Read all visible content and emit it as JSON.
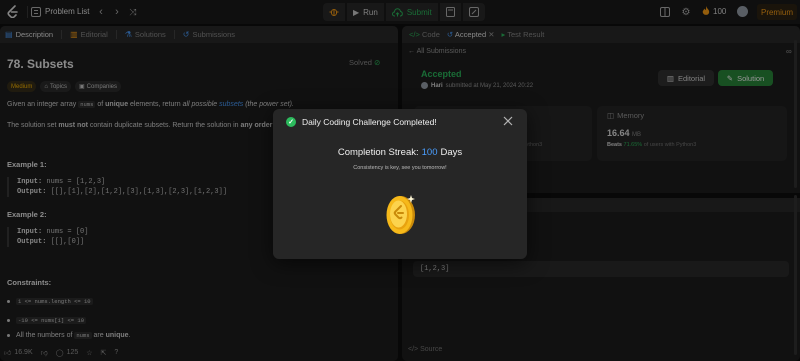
{
  "topbar": {
    "problem_list_label": "Problem List",
    "run_label": "Run",
    "submit_label": "Submit",
    "streak_count": "100",
    "premium_label": "Premium"
  },
  "left_panel": {
    "tabs": [
      {
        "label": "Description"
      },
      {
        "label": "Editorial"
      },
      {
        "label": "Solutions"
      },
      {
        "label": "Submissions"
      }
    ],
    "title": "78. Subsets",
    "solved_label": "Solved",
    "badges": {
      "difficulty": "Medium",
      "topics": "Topics",
      "companies": "Companies"
    },
    "desc_line1": {
      "a": "Given an integer array ",
      "code": "nums",
      "b": " of ",
      "bold": "unique",
      "c": " elements, return ",
      "italic": "all possible ",
      "link": "subsets",
      "d": " (the power set)."
    },
    "desc_line2": {
      "a": "The solution set ",
      "bold": "must not",
      "b": " contain duplicate subsets. Return the solution in ",
      "bold2": "any order",
      "c": "."
    },
    "example1": {
      "heading": "Example 1:",
      "input_label": "Input:",
      "input_value": "nums = [1,2,3]",
      "output_label": "Output:",
      "output_value": "[[],[1],[2],[1,2],[3],[1,3],[2,3],[1,2,3]]"
    },
    "example2": {
      "heading": "Example 2:",
      "input_label": "Input:",
      "input_value": "nums = [0]",
      "output_label": "Output:",
      "output_value": "[[],[0]]"
    },
    "constraints_heading": "Constraints:",
    "constraints": [
      {
        "code": "1 <= nums.length <= 10",
        "text": ""
      },
      {
        "code": "-10 <= nums[i] <= 10",
        "text": ""
      },
      {
        "prefix": "All the numbers of ",
        "code": "nums",
        "text": " are ",
        "bold": "unique",
        "suffix": "."
      }
    ],
    "footer": {
      "likes": "16.9K",
      "comments": "125"
    }
  },
  "right_panel": {
    "tabs": [
      {
        "label": "Code"
      },
      {
        "label": "Accepted"
      },
      {
        "label": "Test Result"
      }
    ],
    "all_submissions": "All Submissions",
    "status": "Accepted",
    "submitter_name": "Hari",
    "submitted_text": "submitted at May 21, 2024 20:22",
    "editorial_label": "Editorial",
    "solution_label": "Solution",
    "memory_label": "Memory",
    "memory_value": "16.64",
    "memory_unit": "MB",
    "memory_beats_label": "Beats",
    "memory_beats_pct": "71.65%",
    "memory_beats_suffix": "of users with Python3",
    "runtime_beats_fragment": "Python3",
    "output_value": "[1,2,3]",
    "source_label": "Source"
  },
  "modal": {
    "title": "Daily Coding Challenge Completed!",
    "streak_label": "Completion Streak:",
    "streak_value": "100",
    "streak_unit": "Days",
    "subtitle": "Consistency is key, see you tomorrow!"
  },
  "colors": {
    "accent_green": "#2cbb5d",
    "accent_orange": "#ffa116",
    "link_blue": "#4a9eff",
    "medium_yellow": "#ffb800"
  }
}
